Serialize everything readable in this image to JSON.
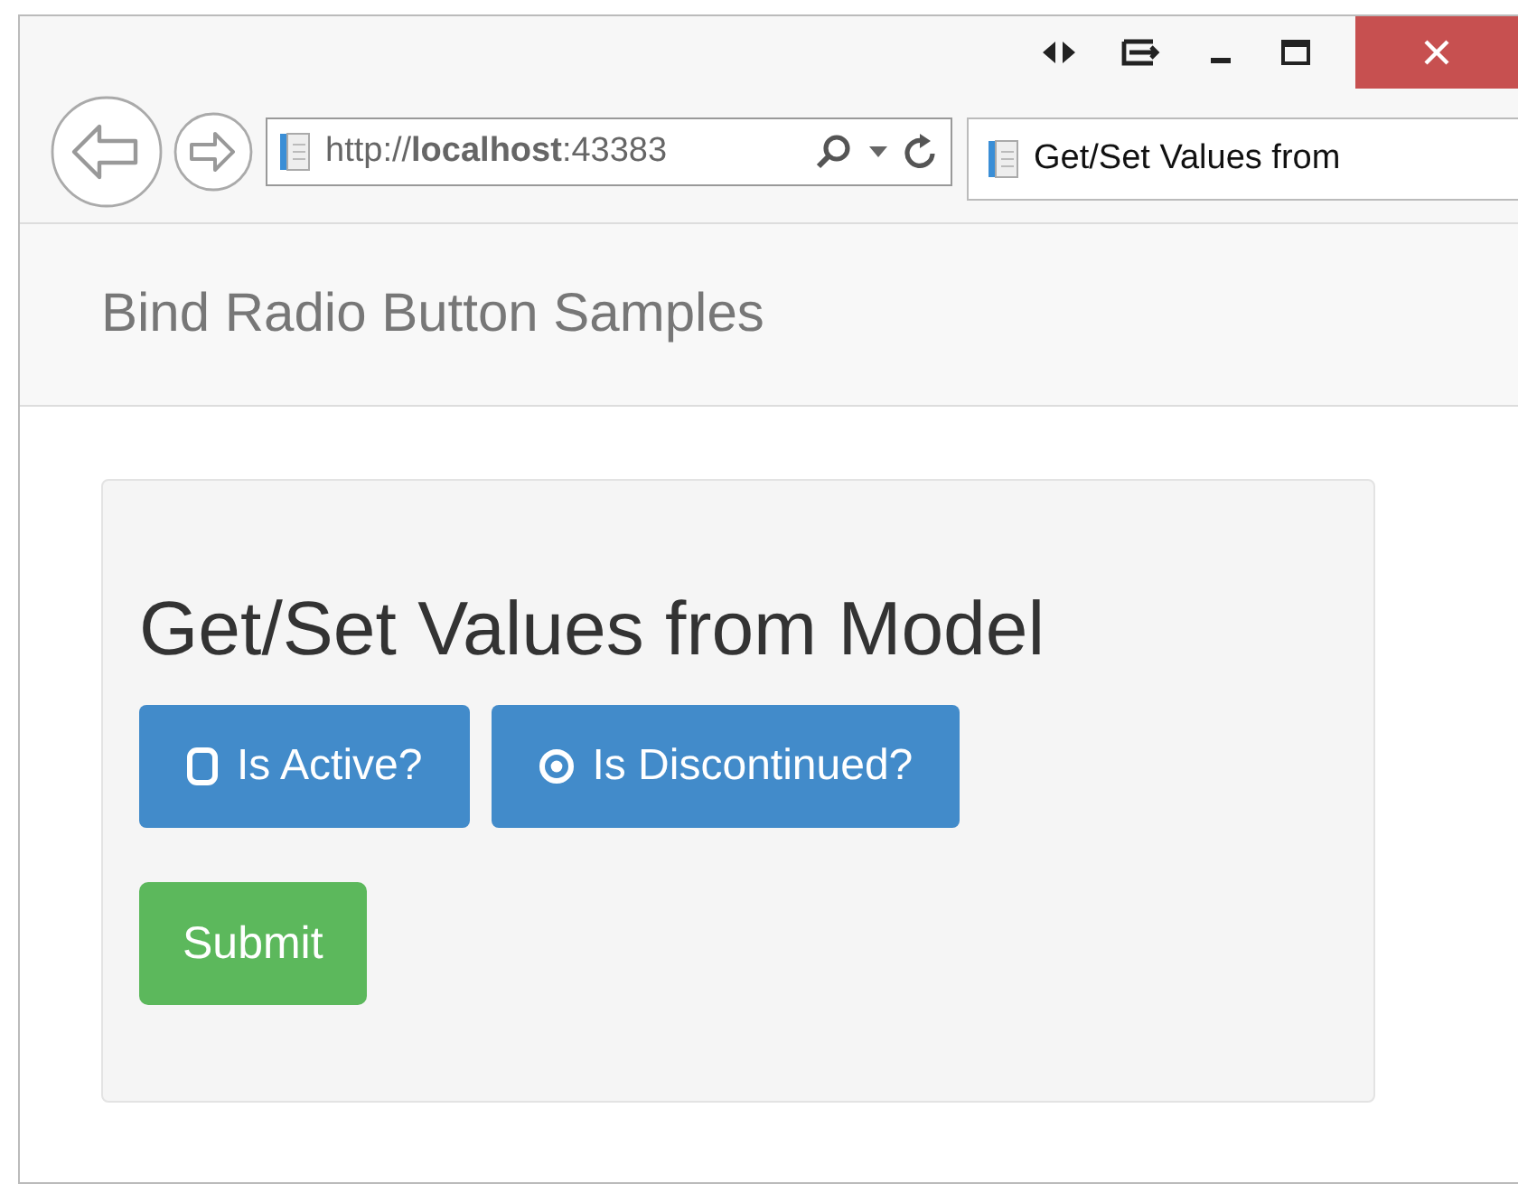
{
  "browser": {
    "address": "http://**localhost**:43383",
    "tab_title": "Get/Set Values from"
  },
  "navbar": {
    "brand": "Bind Radio Button Samples"
  },
  "panel": {
    "heading": "Get/Set Values from Model",
    "options": [
      {
        "label": "Is Active?",
        "selected": false
      },
      {
        "label": "Is Discontinued?",
        "selected": true
      }
    ],
    "submit": "Submit"
  }
}
